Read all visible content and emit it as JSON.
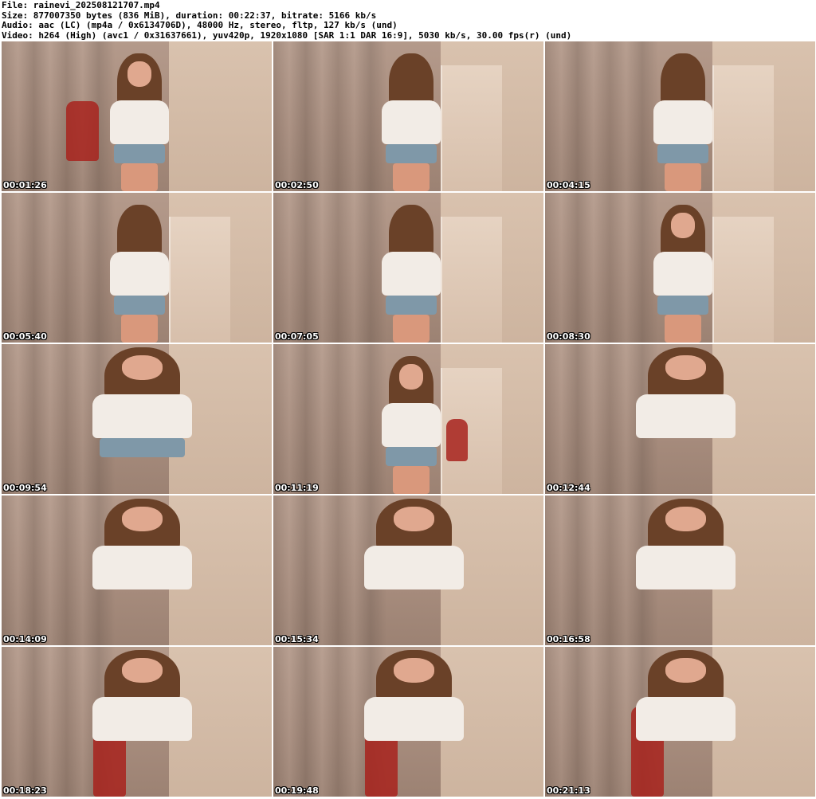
{
  "header": {
    "file_line": "File: rainevi_202508121707.mp4",
    "size_line": "Size: 877007350 bytes (836 MiB), duration: 00:22:37, bitrate: 5166 kb/s",
    "audio_line": "Audio: aac (LC) (mp4a / 0x6134706D), 48000 Hz, stereo, fltp, 127 kb/s (und)",
    "video_line": "Video: h264 (High) (avc1 / 0x31637661), yuv420p, 1920x1080 [SAR 1:1 DAR 16:9], 5030 kb/s, 30.00 fps(r) (und)"
  },
  "thumbnails": [
    {
      "timestamp": "00:01:26"
    },
    {
      "timestamp": "00:02:50"
    },
    {
      "timestamp": "00:04:15"
    },
    {
      "timestamp": "00:05:40"
    },
    {
      "timestamp": "00:07:05"
    },
    {
      "timestamp": "00:08:30"
    },
    {
      "timestamp": "00:09:54"
    },
    {
      "timestamp": "00:11:19"
    },
    {
      "timestamp": "00:12:44"
    },
    {
      "timestamp": "00:14:09"
    },
    {
      "timestamp": "00:15:34"
    },
    {
      "timestamp": "00:16:58"
    },
    {
      "timestamp": "00:18:23"
    },
    {
      "timestamp": "00:19:48"
    },
    {
      "timestamp": "00:21:13"
    }
  ]
}
